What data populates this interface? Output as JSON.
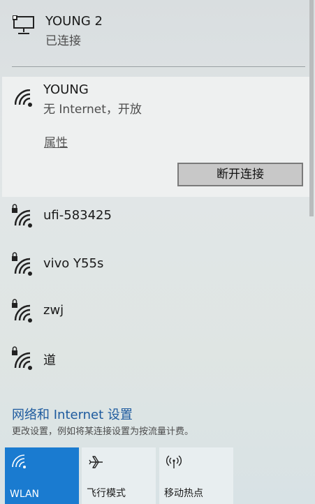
{
  "wired": {
    "name": "YOUNG 2",
    "status": "已连接",
    "icon": "ethernet-icon"
  },
  "selected": {
    "name": "YOUNG",
    "status": "无 Internet，开放",
    "properties_label": "属性",
    "disconnect_label": "断开连接",
    "icon": "wifi-icon"
  },
  "networks": [
    {
      "name": "ufi-583425",
      "icon": "wifi-secured-icon"
    },
    {
      "name": "vivo Y55s",
      "icon": "wifi-secured-icon"
    },
    {
      "name": "zwj",
      "icon": "wifi-secured-icon"
    },
    {
      "name": "道",
      "icon": "wifi-secured-icon"
    }
  ],
  "settings": {
    "link": "网络和 Internet 设置",
    "description": "更改设置，例如将某连接设置为按流量计费。"
  },
  "tiles": [
    {
      "label": "WLAN",
      "icon": "wifi-icon",
      "active": true
    },
    {
      "label": "飞行模式",
      "icon": "airplane-icon",
      "active": false
    },
    {
      "label": "移动热点",
      "icon": "hotspot-icon",
      "active": false
    }
  ],
  "colors": {
    "accent": "#1a7bd0",
    "link": "#1d5a9e"
  }
}
